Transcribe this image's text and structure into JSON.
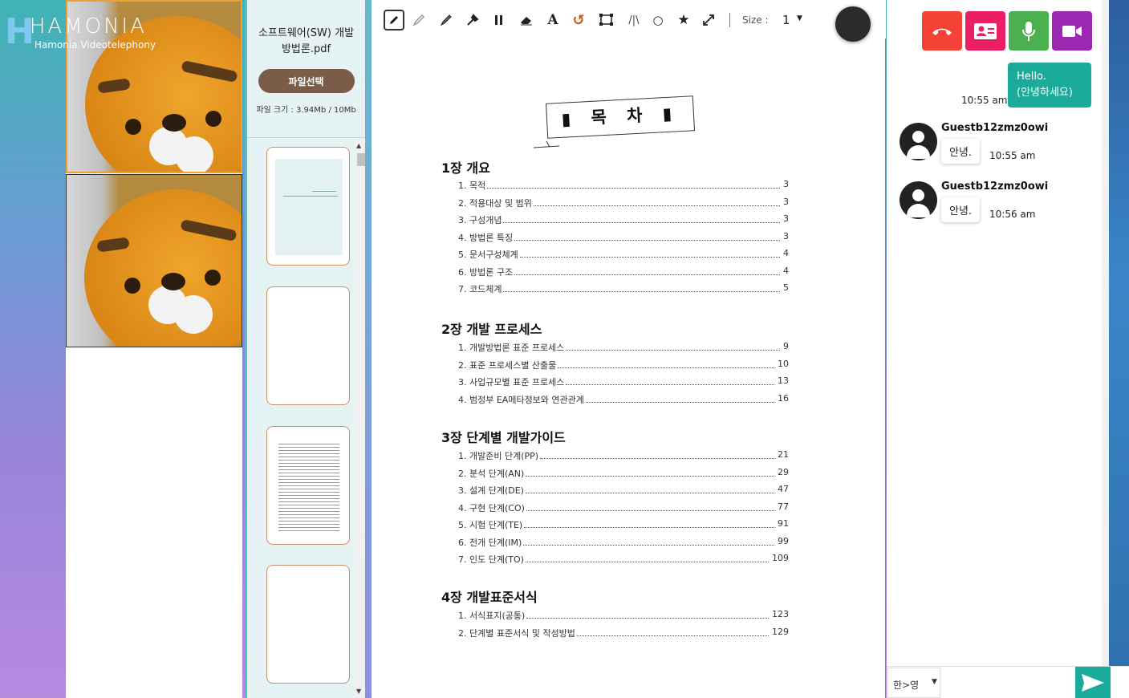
{
  "app": {
    "name": "HAMONIA",
    "subtitle": "Hamonia Videotelephony"
  },
  "file_panel": {
    "file_name": "소프트웨어(SW) 개발 방법론.pdf",
    "select_button": "파일선택",
    "file_size": "파일 크기 : 3.94Mb / 10Mb"
  },
  "toolbar": {
    "size_label": "Size :",
    "size_value": "1",
    "active_color": "#2b2b2b",
    "tools": [
      "pen-icon",
      "pencil-icon",
      "marker-icon",
      "magic-pen-icon",
      "highlighter-icon",
      "eraser-icon",
      "text-icon",
      "undo-icon",
      "select-icon",
      "line-icon",
      "circle-icon",
      "star-icon",
      "fullscreen-icon"
    ]
  },
  "document": {
    "title": "▮ 목 차 ▮",
    "chapters": [
      {
        "title": "1장 개요",
        "items": [
          {
            "label": "1. 목적",
            "page": "3"
          },
          {
            "label": "2. 적용대상 및 범위",
            "page": "3"
          },
          {
            "label": "3. 구성개념",
            "page": "3"
          },
          {
            "label": "4. 방법론 특징",
            "page": "3"
          },
          {
            "label": "5. 문서구성체계",
            "page": "4"
          },
          {
            "label": "6. 방법론 구조",
            "page": "4"
          },
          {
            "label": "7. 코드체계",
            "page": "5"
          }
        ]
      },
      {
        "title": "2장 개발 프로세스",
        "items": [
          {
            "label": "1. 개발방법론 표준 프로세스",
            "page": "9"
          },
          {
            "label": "2. 표준 프로세스별 산출물",
            "page": "10"
          },
          {
            "label": "3. 사업규모별 표준 프로세스",
            "page": "13"
          },
          {
            "label": "4. 범정부 EA메타정보와 연관관계",
            "page": "16"
          }
        ]
      },
      {
        "title": "3장 단계별 개발가이드",
        "items": [
          {
            "label": "1. 개발준비 단계(PP)",
            "page": "21"
          },
          {
            "label": "2. 분석 단계(AN)",
            "page": "29"
          },
          {
            "label": "3. 설계 단계(DE)",
            "page": "47"
          },
          {
            "label": "4. 구현 단계(CO)",
            "page": "77"
          },
          {
            "label": "5. 시험 단계(TE)",
            "page": "91"
          },
          {
            "label": "6. 전개 단계(IM)",
            "page": "99"
          },
          {
            "label": "7. 인도 단계(TO)",
            "page": "109"
          }
        ]
      },
      {
        "title": "4장 개발표준서식",
        "items": [
          {
            "label": "1. 서식표지(공통)",
            "page": "123"
          },
          {
            "label": "2. 단계별 표준서식 및 작성방법",
            "page": "129"
          }
        ]
      }
    ]
  },
  "chat": {
    "controls": [
      {
        "name": "hangup-button",
        "icon": "phone-hangup-icon",
        "color": "#f44336"
      },
      {
        "name": "contact-button",
        "icon": "contact-card-icon",
        "color": "#e91e63"
      },
      {
        "name": "mic-button",
        "icon": "microphone-icon",
        "color": "#4caf50"
      },
      {
        "name": "video-button",
        "icon": "video-camera-icon",
        "color": "#9c27b0"
      }
    ],
    "my_message": {
      "text_line1": "Hello.",
      "text_line2": "(안녕하세요)",
      "time": "10:55 am"
    },
    "messages": [
      {
        "sender": "Guestb12zmz0owi",
        "text": "안녕.",
        "time": "10:55 am"
      },
      {
        "sender": "Guestb12zmz0owi",
        "text": "안녕.",
        "time": "10:56 am"
      }
    ],
    "input": {
      "lang_toggle": "한>영",
      "placeholder": ""
    }
  }
}
